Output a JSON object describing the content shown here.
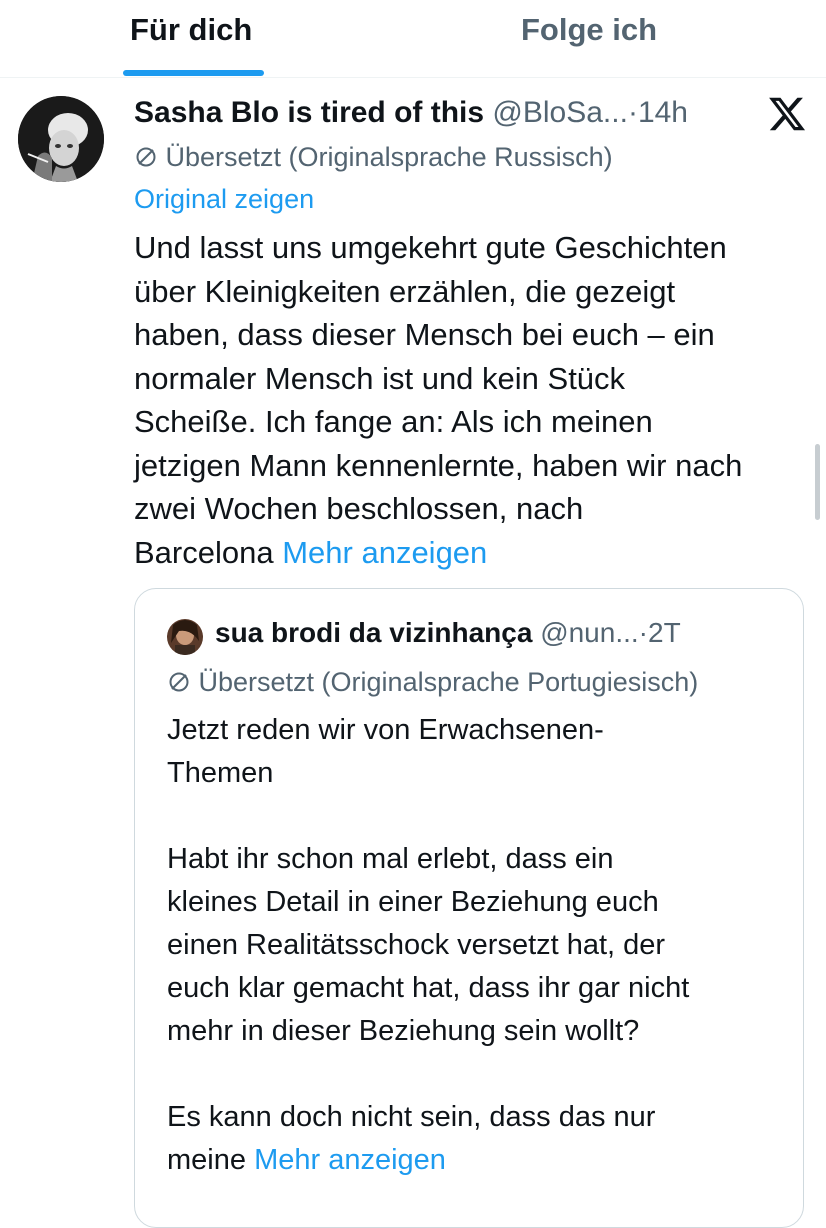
{
  "tabs": [
    {
      "label": "Für dich",
      "active": true
    },
    {
      "label": "Folge ich",
      "active": false
    }
  ],
  "tweet": {
    "author_name": "Sasha Blo is tired of this",
    "handle": "@BloSa...",
    "separator": "·",
    "time": "14h",
    "translated_label": "Übersetzt (Originalsprache Russisch)",
    "show_original": "Original zeigen",
    "body_lines": [
      "Und lasst uns umgekehrt gute Geschichten",
      "über Kleinigkeiten erzählen, die gezeigt",
      "haben, dass dieser Mensch bei euch – ein",
      "normaler Mensch ist und kein Stück",
      "Scheiße. Ich fange an: Als ich meinen",
      "jetzigen Mann kennenlernte, haben wir nach",
      "zwei Wochen beschlossen, nach",
      "Barcelona"
    ],
    "more": "Mehr anzeigen"
  },
  "quote": {
    "author_name": "sua brodi da vizinhança",
    "handle": "@nun...",
    "separator": "·",
    "time": "2T",
    "translated_label": "Übersetzt (Originalsprache Portugiesisch)",
    "body_lines": [
      "Jetzt reden wir von Erwachsenen-",
      "Themen",
      "",
      "Habt ihr schon mal erlebt, dass ein",
      "kleines Detail in einer Beziehung euch",
      "einen Realitätsschock versetzt hat, der",
      "euch klar gemacht hat, dass ihr gar nicht",
      "mehr in dieser Beziehung sein wollt?",
      "",
      "Es kann doch nicht sein, dass das nur",
      "meine"
    ],
    "more": "Mehr anzeigen"
  },
  "icons": {
    "translate": "translate-icon",
    "x_logo": "x-logo-icon"
  },
  "colors": {
    "accent": "#1d9bf0",
    "text_primary": "#0f1419",
    "text_secondary": "#536471",
    "border": "#cfd9de"
  }
}
